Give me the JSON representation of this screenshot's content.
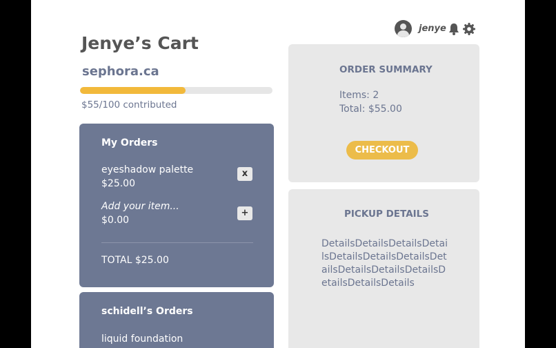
{
  "header": {
    "username": "jenye"
  },
  "cart": {
    "title": "Jenye’s Cart",
    "store": "sephora.ca",
    "progress": 0.55,
    "contributed_text": "$55/100 contributed"
  },
  "my_orders": {
    "title": "My Orders",
    "items": [
      {
        "name": "eyeshadow palette",
        "price": "$25.00",
        "action": "x"
      },
      {
        "name": "Add your item...",
        "price": "$0.00",
        "action": "+"
      }
    ],
    "total": "TOTAL $25.00"
  },
  "other_orders": {
    "title": "schidell’s Orders",
    "items": [
      {
        "name": "liquid foundation"
      }
    ]
  },
  "order_summary": {
    "title": "ORDER SUMMARY",
    "items_line": "Items: 2",
    "total_line": "Total: $55.00",
    "checkout_label": "CHECKOUT"
  },
  "pickup": {
    "title": "PICKUP DETAILS",
    "details": "DetailsDetailsDetailsDetailsDetailsDetailsDetailsDetailsDetailsDetailsDetailsDetailsDetailsDetails"
  },
  "colors": {
    "accent": "#f2b93b",
    "card_blue": "#6d7893",
    "card_gray": "#e8e8e8",
    "text_blue": "#6b7590"
  },
  "icons": [
    "user-avatar-icon",
    "bell-icon",
    "gear-icon"
  ]
}
